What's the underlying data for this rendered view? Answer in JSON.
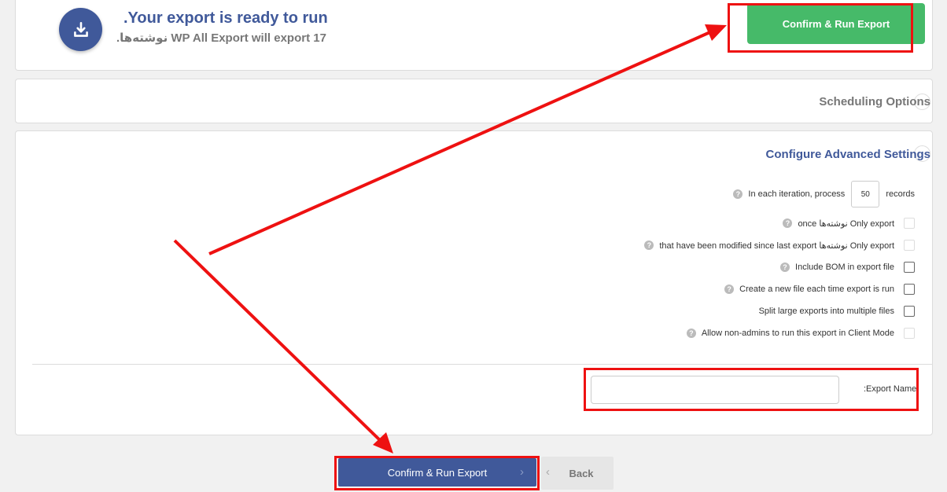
{
  "header": {
    "title": ".Your export is ready to run",
    "subtitle": "WP All Export will export 17 نوشته‌ها.",
    "confirm_label": "Confirm & Run Export",
    "icon": "download-icon"
  },
  "scheduling": {
    "title": "Scheduling Options"
  },
  "advanced": {
    "title": "Configure Advanced Settings",
    "iteration_prefix": "In each iteration, process",
    "iteration_value": "50",
    "iteration_suffix": "records",
    "options": [
      {
        "label": "Only export نوشته‌ها once",
        "has_help": true,
        "disabled": true
      },
      {
        "label": "Only export نوشته‌ها that have been modified since last export",
        "has_help": true,
        "disabled": true
      },
      {
        "label": "Include BOM in export file",
        "has_help": true,
        "disabled": false
      },
      {
        "label": "Create a new file each time export is run",
        "has_help": true,
        "disabled": false
      },
      {
        "label": "Split large exports into multiple files",
        "has_help": false,
        "disabled": false
      },
      {
        "label": "Allow non-admins to run this export in Client Mode",
        "has_help": true,
        "disabled": true
      }
    ],
    "export_name_label": ":Export Name",
    "export_name_value": ""
  },
  "footer": {
    "confirm_label": "Confirm & Run Export",
    "back_label": "Back"
  },
  "colors": {
    "primary": "#40599a",
    "success": "#46ba69",
    "highlight": "#ee1111"
  }
}
